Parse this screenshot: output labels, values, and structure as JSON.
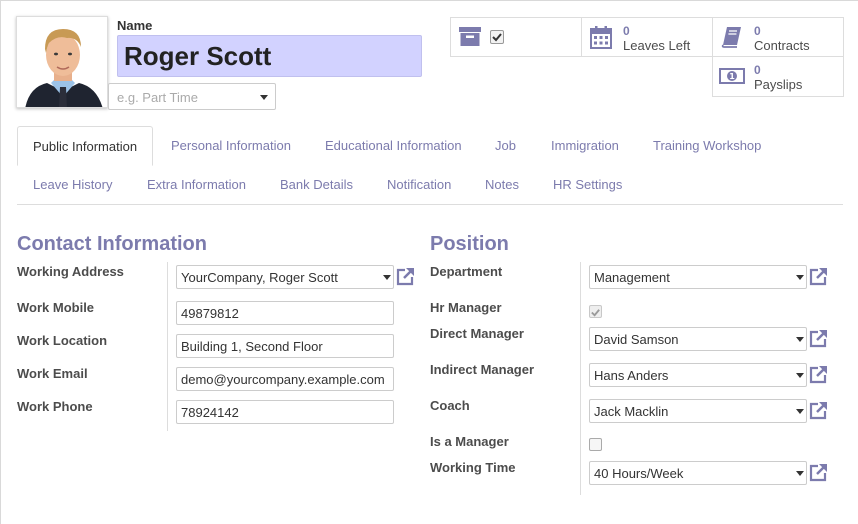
{
  "employee": {
    "name_label": "Name",
    "name": "Roger Scott",
    "job_placeholder": "e.g. Part Time"
  },
  "stats": {
    "leaves": {
      "count": "0",
      "label": "Leaves Left"
    },
    "contracts": {
      "count": "0",
      "label": "Contracts"
    },
    "payslips": {
      "count": "0",
      "label": "Payslips"
    }
  },
  "tabs": {
    "row1": [
      "Public Information",
      "Personal Information",
      "Educational Information",
      "Job",
      "Immigration",
      "Training Workshop"
    ],
    "row2": [
      "Leave History",
      "Extra Information",
      "Bank Details",
      "Notification",
      "Notes",
      "HR Settings"
    ]
  },
  "contact": {
    "title": "Contact Information",
    "working_address_label": "Working Address",
    "working_address": "YourCompany, Roger Scott",
    "work_mobile_label": "Work Mobile",
    "work_mobile": "49879812",
    "work_location_label": "Work Location",
    "work_location": "Building 1, Second Floor",
    "work_email_label": "Work Email",
    "work_email": "demo@yourcompany.example.com",
    "work_phone_label": "Work Phone",
    "work_phone": "78924142"
  },
  "position": {
    "title": "Position",
    "department_label": "Department",
    "department": "Management",
    "hr_manager_label": "Hr Manager",
    "hr_manager_checked": true,
    "direct_manager_label": "Direct Manager",
    "direct_manager": "David Samson",
    "indirect_manager_label": "Indirect Manager",
    "indirect_manager": "Hans Anders",
    "coach_label": "Coach",
    "coach": "Jack Macklin",
    "is_manager_label": "Is a Manager",
    "is_manager_checked": false,
    "working_time_label": "Working Time",
    "working_time": "40 Hours/Week"
  },
  "colors": {
    "accent": "#7c7bad",
    "name_bg": "#d2d2ff"
  }
}
